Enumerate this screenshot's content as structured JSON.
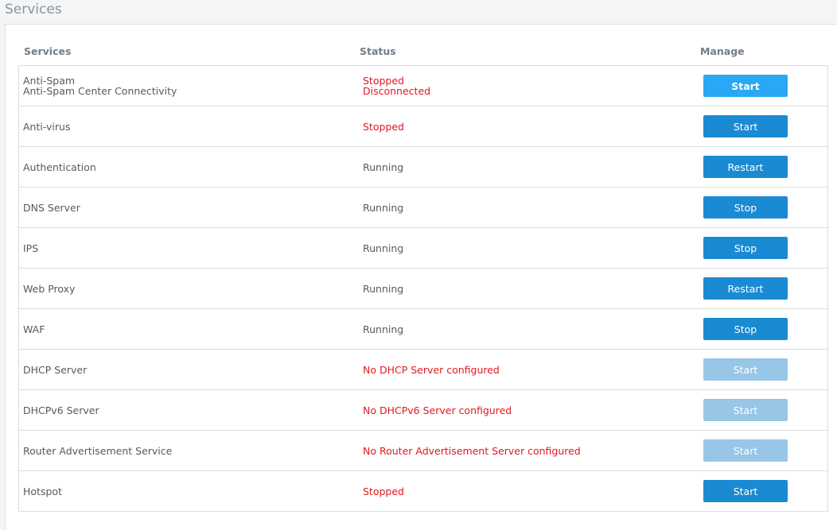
{
  "page": {
    "title": "Services"
  },
  "columns": {
    "services": "Services",
    "status": "Status",
    "manage": "Manage"
  },
  "colors": {
    "accent": "#1a8ad3",
    "accent_hover": "#29a8f6",
    "disabled": "#97c6e6",
    "error": "#e0191f"
  },
  "rows": [
    {
      "name": [
        "Anti-Spam",
        "Anti-Spam Center Connectivity"
      ],
      "status": [
        "Stopped",
        "Disconnected"
      ],
      "status_error": true,
      "action": "Start",
      "button_state": "hover"
    },
    {
      "name": [
        "Anti-virus"
      ],
      "status": [
        "Stopped"
      ],
      "status_error": true,
      "action": "Start",
      "button_state": "enabled"
    },
    {
      "name": [
        "Authentication"
      ],
      "status": [
        "Running"
      ],
      "status_error": false,
      "action": "Restart",
      "button_state": "enabled"
    },
    {
      "name": [
        "DNS Server"
      ],
      "status": [
        "Running"
      ],
      "status_error": false,
      "action": "Stop",
      "button_state": "enabled"
    },
    {
      "name": [
        "IPS"
      ],
      "status": [
        "Running"
      ],
      "status_error": false,
      "action": "Stop",
      "button_state": "enabled"
    },
    {
      "name": [
        "Web Proxy"
      ],
      "status": [
        "Running"
      ],
      "status_error": false,
      "action": "Restart",
      "button_state": "enabled"
    },
    {
      "name": [
        "WAF"
      ],
      "status": [
        "Running"
      ],
      "status_error": false,
      "action": "Stop",
      "button_state": "enabled"
    },
    {
      "name": [
        "DHCP Server"
      ],
      "status": [
        "No DHCP Server configured"
      ],
      "status_error": true,
      "action": "Start",
      "button_state": "disabled"
    },
    {
      "name": [
        "DHCPv6 Server"
      ],
      "status": [
        "No DHCPv6 Server configured"
      ],
      "status_error": true,
      "action": "Start",
      "button_state": "disabled"
    },
    {
      "name": [
        "Router Advertisement Service"
      ],
      "status": [
        "No Router Advertisement Server configured"
      ],
      "status_error": true,
      "action": "Start",
      "button_state": "disabled"
    },
    {
      "name": [
        "Hotspot"
      ],
      "status": [
        "Stopped"
      ],
      "status_error": true,
      "action": "Start",
      "button_state": "enabled"
    }
  ]
}
